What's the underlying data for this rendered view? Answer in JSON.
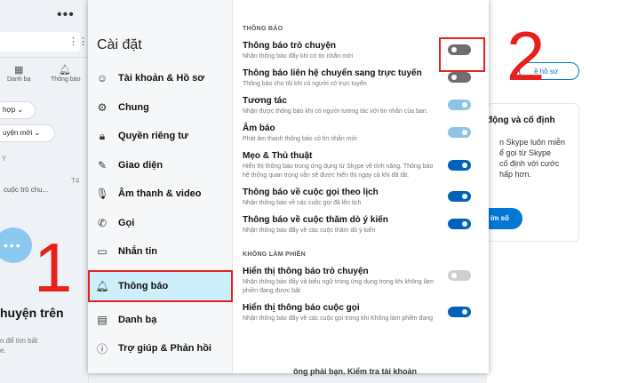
{
  "left_panel": {
    "nav": [
      {
        "label": "Danh bạ",
        "icon": "contacts-icon"
      },
      {
        "label": "Thông báo",
        "icon": "bell-icon"
      }
    ],
    "pill1": "hợp",
    "pill2": "uyện mới",
    "meta1": "Y",
    "chat_preview": "cuộc trò chu...",
    "chat_time": "T4",
    "heading": "huyện trên",
    "subtext1": "n để tìm bất",
    "subtext2": "e."
  },
  "right_panel": {
    "profile_btn": "ề hồ sơ",
    "card_title": "động và cố định",
    "card_text1": "n Skype luôn miễn",
    "card_text2": "ể gọi từ Skype",
    "card_text3": "cố định với cước",
    "card_text4": "hấp hơn.",
    "card_btn": "ím số"
  },
  "settings": {
    "title": "Cài đặt",
    "menu": [
      {
        "label": "Tài khoản & Hồ sơ",
        "icon": "account-icon"
      },
      {
        "label": "Chung",
        "icon": "gear-icon"
      },
      {
        "label": "Quyền riêng tư",
        "icon": "lock-icon"
      },
      {
        "label": "Giao diện",
        "icon": "appearance-icon"
      },
      {
        "label": "Âm thanh & video",
        "icon": "microphone-icon"
      },
      {
        "label": "Gọi",
        "icon": "phone-icon"
      },
      {
        "label": "Nhắn tin",
        "icon": "message-icon"
      },
      {
        "label": "Thông báo",
        "icon": "bell-icon"
      },
      {
        "label": "Danh bạ",
        "icon": "contacts-icon"
      },
      {
        "label": "Trợ giúp & Phản hồi",
        "icon": "info-icon"
      }
    ],
    "section1": "THÔNG BÁO",
    "section2": "KHÔNG LÀM PHIỀN",
    "items": [
      {
        "title": "Thông báo trò chuyện",
        "desc": "Nhận thông báo đẩy khi có tin nhắn mới",
        "state": "off"
      },
      {
        "title": "Thông báo liên hệ chuyển sang trực tuyến",
        "desc": "Thông báo cho tôi khi có người có trực tuyến",
        "state": "off"
      },
      {
        "title": "Tương tác",
        "desc": "Nhận được thông báo khi có người tương tác với tin nhắn của bạn.",
        "state": "dis"
      },
      {
        "title": "Âm báo",
        "desc": "Phát âm thanh thông báo có tin nhắn mới",
        "state": "dis"
      },
      {
        "title": "Mẹo & Thủ thuật",
        "desc": "Hiển thị thông báo trong ứng dụng từ Skype về tính năng. Thông báo hệ thống quan trọng vẫn sẽ được hiển thị ngay cả khi đã tắt.",
        "state": "on"
      },
      {
        "title": "Thông báo về cuộc gọi theo lịch",
        "desc": "Nhận thông báo về các cuộc gọi đã lên lịch",
        "state": "on"
      },
      {
        "title": "Thông báo về cuộc thăm dò ý kiến",
        "desc": "Nhận thông báo đẩy về các cuộc thăm dò ý kiến",
        "state": "on"
      }
    ],
    "dnd_items": [
      {
        "title": "Hiển thị thông báo trò chuyện",
        "desc": "Nhận thông báo đẩy và biểu ngữ trong ứng dụng trong khi không làm phiền đang được bật",
        "state": "disoff"
      },
      {
        "title": "Hiển thị thông báo cuộc gọi",
        "desc": "Nhận thông báo đẩy về các cuộc gọi trong khi Không làm phiền đang",
        "state": "on"
      }
    ]
  },
  "annotations": {
    "num1": "1",
    "num2": "2"
  },
  "bottom_text": "ông phải bạn. Kiểm tra tài khoản"
}
